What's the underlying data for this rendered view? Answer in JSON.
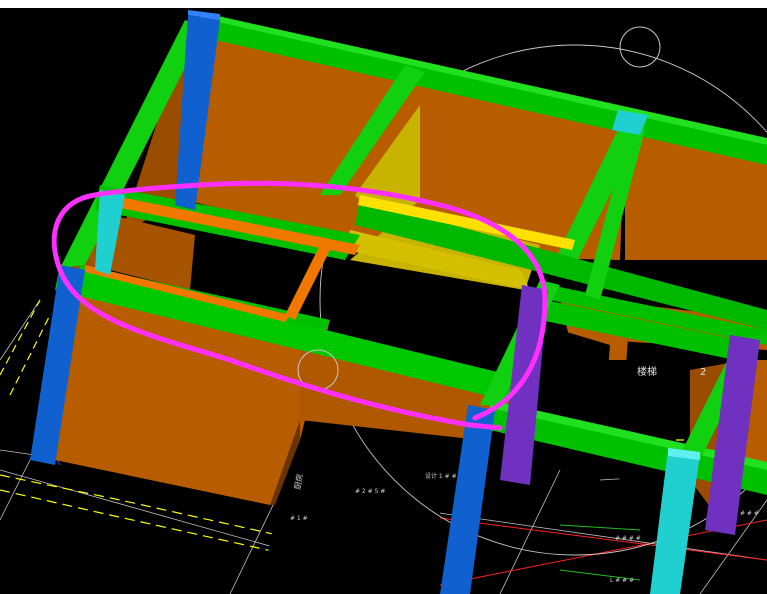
{
  "viewport": {
    "background": "#000000",
    "labels": {
      "stair": "楼梯",
      "stair_num": "2",
      "room": "厨房",
      "note_1": "# 2 # 5 #",
      "note_2": "设计 1 # #",
      "note_3": "# # # #",
      "note_4": "# # #",
      "note_5": "L # # #",
      "note_6": "# 1 #"
    }
  },
  "colors": {
    "wall": "#b85c00",
    "beam": "#00c800",
    "column_blue": "#1060d0",
    "column_cyan": "#20d0d0",
    "column_purple": "#7030c0",
    "selected_beam_orange": "#f07800",
    "selected_beam_yellow": "#ffe000",
    "highlight_outline": "#ff30ff",
    "cad_line_yellow": "#ffff00",
    "cad_line_red": "#ff2020",
    "cad_line_white": "#c0c0c0",
    "cad_line_green": "#20c020"
  }
}
